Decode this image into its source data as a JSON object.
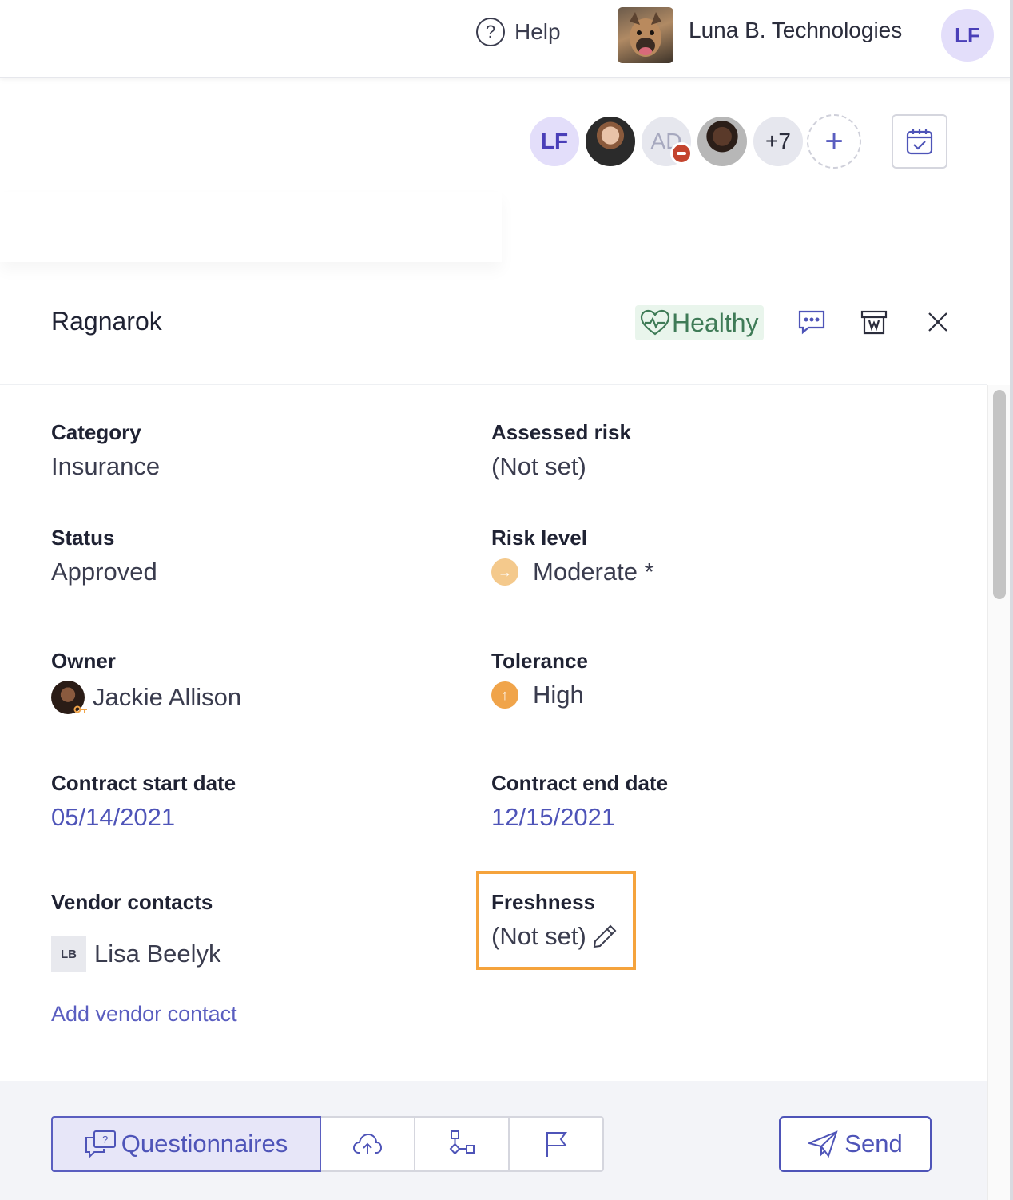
{
  "header": {
    "help_label": "Help",
    "help_icon_glyph": "?",
    "org_name": "Luna B. Technologies",
    "user_initials": "LF"
  },
  "collaborators": {
    "first_initials": "LF",
    "third_initials": "AD",
    "overflow_count": "+7",
    "add_glyph": "+"
  },
  "panel": {
    "title": "Ragnarok",
    "health_label": "Healthy"
  },
  "fields": {
    "category": {
      "label": "Category",
      "value": "Insurance"
    },
    "assessed_risk": {
      "label": "Assessed risk",
      "value": "(Not set)"
    },
    "status": {
      "label": "Status",
      "value": "Approved"
    },
    "risk_level": {
      "label": "Risk level",
      "value": "Moderate *",
      "icon": "arrow-right-icon",
      "icon_glyph": "→",
      "color": "#f4c98c"
    },
    "owner": {
      "label": "Owner",
      "value": "Jackie Allison"
    },
    "tolerance": {
      "label": "Tolerance",
      "value": "High",
      "icon": "arrow-up-icon",
      "icon_glyph": "↑",
      "color": "#f0a44a"
    },
    "contract_start": {
      "label": "Contract start date",
      "value": "05/14/2021"
    },
    "contract_end": {
      "label": "Contract end date",
      "value": "12/15/2021"
    },
    "vendor_contacts": {
      "label": "Vendor contacts",
      "contact_initials": "LB",
      "contact_name": "Lisa Beelyk",
      "add_label": "Add vendor contact"
    },
    "freshness": {
      "label": "Freshness",
      "value": "(Not set)"
    }
  },
  "toolbar": {
    "questionnaires_label": "Questionnaires",
    "send_label": "Send"
  },
  "colors": {
    "accent": "#4e54b8",
    "highlight": "#f5a33c",
    "healthy_green": "#3f7b57"
  }
}
